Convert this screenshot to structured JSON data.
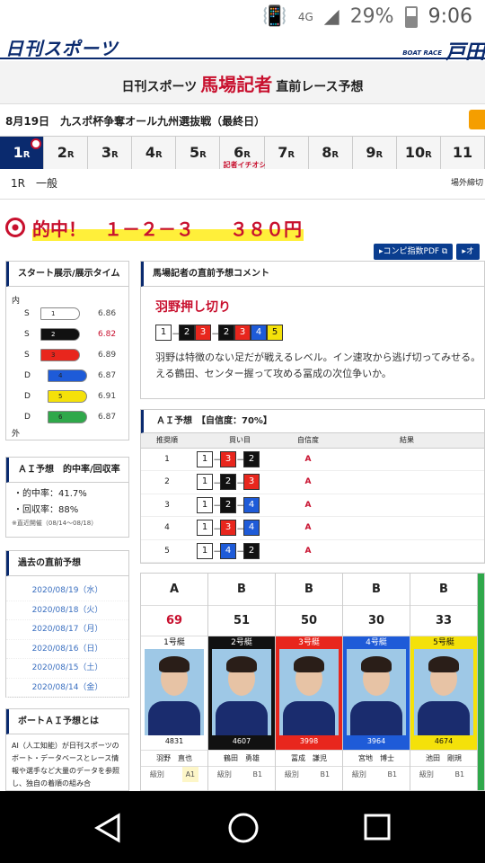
{
  "status": {
    "net": "4G",
    "battery": "29%",
    "time": "9:06"
  },
  "header": {
    "logo": "日刊スポーツ",
    "brand_small": "BOAT RACE",
    "brand": "戸田"
  },
  "title": {
    "prefix": "日刊スポーツ",
    "main": "馬場記者",
    "suffix": "直前レース予想"
  },
  "race": {
    "date": "8月19日",
    "name": "九スポ杯争奪オール九州選抜戦（最終日）"
  },
  "tabs": [
    {
      "num": "1",
      "unit": "R",
      "active": true
    },
    {
      "num": "2",
      "unit": "R"
    },
    {
      "num": "3",
      "unit": "R"
    },
    {
      "num": "4",
      "unit": "R"
    },
    {
      "num": "5",
      "unit": "R"
    },
    {
      "num": "6",
      "unit": "R",
      "badge": "記者イチオシ"
    },
    {
      "num": "7",
      "unit": "R"
    },
    {
      "num": "8",
      "unit": "R"
    },
    {
      "num": "9",
      "unit": "R"
    },
    {
      "num": "10",
      "unit": "R"
    },
    {
      "num": "11",
      "unit": ""
    }
  ],
  "race_info": {
    "label": "1R　一般",
    "deadline": "場外締切"
  },
  "hit": {
    "text": "的中！　１－２－３　　３８０円"
  },
  "buttons": {
    "pdf": "▸コンピ指数PDF ⧉",
    "other": "▸オ"
  },
  "exhibit": {
    "title": "スタート展示/展示タイム",
    "inner": "内",
    "outer": "外",
    "rows": [
      {
        "lane": "S",
        "boat": "1",
        "color": "#ffffff",
        "time": "6.86",
        "red": false
      },
      {
        "lane": "S",
        "boat": "2",
        "color": "#111111",
        "time": "6.82",
        "red": true
      },
      {
        "lane": "S",
        "boat": "3",
        "color": "#e8261d",
        "time": "6.89",
        "red": false
      },
      {
        "lane": "D",
        "boat": "4",
        "color": "#1e5bd8",
        "time": "6.87",
        "red": false
      },
      {
        "lane": "D",
        "boat": "5",
        "color": "#f4e10a",
        "time": "6.91",
        "red": false
      },
      {
        "lane": "D",
        "boat": "6",
        "color": "#2fa84a",
        "time": "6.87",
        "red": false
      }
    ]
  },
  "ai_rate": {
    "title": "ＡＩ予想　的中率/回収率",
    "hit_rate": "・的中率：41.7%",
    "return_rate": "・回収率：88%",
    "note": "※直近開催（08/14～08/18）"
  },
  "past": {
    "title": "過去の直前予想",
    "dates": [
      "2020/08/19（水）",
      "2020/08/18（火）",
      "2020/08/17（月）",
      "2020/08/16（日）",
      "2020/08/15（土）",
      "2020/08/14（金）"
    ]
  },
  "about": {
    "title": "ボートＡＩ予想とは",
    "text": "AI（人工知能）が日刊スポーツのボート・データベースとレース情報や選手など大量のデータを参照し、独自の着順の組み合"
  },
  "comment": {
    "title": "馬場記者の直前予想コメント",
    "headline": "羽野押し切り",
    "picks": [
      [
        "1"
      ],
      [
        "2",
        "3"
      ],
      [
        "2",
        "3",
        "4",
        "5"
      ]
    ],
    "text1": "羽野は特徴のない足だが戦えるレベル。イン速攻から逃げ切ってみせる。",
    "text2": "える鶴田、センター握って攻める冨成の次位争いか。"
  },
  "ai": {
    "title": "ＡＩ予想　【自信度：70%】",
    "headers": [
      "推奨順",
      "買い目",
      "自信度",
      "結果"
    ],
    "rows": [
      {
        "rank": "1",
        "combo": [
          "1",
          "3",
          "2"
        ],
        "conf": "A"
      },
      {
        "rank": "2",
        "combo": [
          "1",
          "2",
          "3"
        ],
        "conf": "A"
      },
      {
        "rank": "3",
        "combo": [
          "1",
          "2",
          "4"
        ],
        "conf": "A"
      },
      {
        "rank": "4",
        "combo": [
          "1",
          "3",
          "4"
        ],
        "conf": "A"
      },
      {
        "rank": "5",
        "combo": [
          "1",
          "4",
          "2"
        ],
        "conf": "A"
      }
    ]
  },
  "racers": [
    {
      "grade": "A",
      "score": "69",
      "boat": "1号艇",
      "id": "4831",
      "name": "羽野　直也",
      "cls_label": "級別",
      "cls": "A1"
    },
    {
      "grade": "B",
      "score": "51",
      "boat": "2号艇",
      "id": "4607",
      "name": "鶴田　勇雄",
      "cls_label": "級別",
      "cls": "B1"
    },
    {
      "grade": "B",
      "score": "50",
      "boat": "3号艇",
      "id": "3998",
      "name": "冨成　謙児",
      "cls_label": "級別",
      "cls": "B1"
    },
    {
      "grade": "B",
      "score": "30",
      "boat": "4号艇",
      "id": "3964",
      "name": "宮地　博士",
      "cls_label": "級別",
      "cls": "B1"
    },
    {
      "grade": "B",
      "score": "33",
      "boat": "5号艇",
      "id": "4674",
      "name": "池田　剛規",
      "cls_label": "級別",
      "cls": "B1"
    }
  ],
  "boat_colors": {
    "1": "#ffffff",
    "2": "#111111",
    "3": "#e8261d",
    "4": "#1e5bd8",
    "5": "#f4e10a",
    "6": "#2fa84a"
  },
  "nav": {
    "back": "back-icon",
    "home": "home-icon",
    "recent": "recent-apps-icon"
  }
}
